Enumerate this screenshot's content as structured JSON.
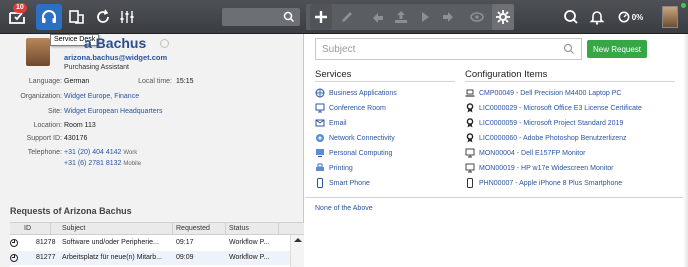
{
  "toolbar": {
    "inbox_badge": "10",
    "percent": "0%"
  },
  "contact": {
    "tooltip": "Service Desk",
    "name_visible": "a Bachus",
    "email": "arizona.bachus@widget.com",
    "job_title": "Purchasing Assistant",
    "fields": {
      "language_label": "Language:",
      "language": "German",
      "local_time_label": "Local time:",
      "local_time": "15:15",
      "organization_label": "Organization:",
      "organization": "Widget Europe, Finance",
      "site_label": "Site:",
      "site": "Widget European Headquarters",
      "location_label": "Location:",
      "location": "Room 113",
      "support_id_label": "Support ID:",
      "support_id": "430176",
      "telephone_label": "Telephone:",
      "phone_work": "+31 (20) 404 4142",
      "phone_work_type": "Work",
      "phone_mobile": "+31 (6) 2781 8132",
      "phone_mobile_type": "Mobile"
    }
  },
  "requests": {
    "title": "Requests of Arizona Bachus",
    "columns": [
      "ID",
      "Subject",
      "Requested",
      "Status"
    ],
    "rows": [
      {
        "id": "81278",
        "subject": "Software und/oder Peripherie...",
        "requested": "09:17",
        "status": "Workflow P..."
      },
      {
        "id": "81277",
        "subject": "Arbeitsplatz für neue(n) Mitarb...",
        "requested": "09:09",
        "status": "Workflow P..."
      }
    ]
  },
  "subject": {
    "placeholder": "Subject"
  },
  "new_request_label": "New Request",
  "services": {
    "title": "Services",
    "items": [
      {
        "label": "Business Applications",
        "icon": "globe-apps-icon"
      },
      {
        "label": "Conference Room",
        "icon": "presentation-icon"
      },
      {
        "label": "Email",
        "icon": "envelope-icon"
      },
      {
        "label": "Network Connectivity",
        "icon": "network-icon"
      },
      {
        "label": "Personal Computing",
        "icon": "computer-icon"
      },
      {
        "label": "Printing",
        "icon": "printer-icon"
      },
      {
        "label": "Smart Phone",
        "icon": "smartphone-icon"
      }
    ]
  },
  "config_items": {
    "title": "Configuration Items",
    "items": [
      {
        "label": "CMP00049 - Dell Precision M4400 Laptop PC",
        "icon": "laptop-icon"
      },
      {
        "label": "LIC0000029 - Microsoft Office E3 License Certificate",
        "icon": "license-ribbon-icon"
      },
      {
        "label": "LIC0000059 - Microsoft Project Standard 2019",
        "icon": "license-ribbon-icon"
      },
      {
        "label": "LIC0000060 - Adobe Photoshop Benutzerlizenz",
        "icon": "license-ribbon-icon"
      },
      {
        "label": "MON00004 - Dell E157FP Monitor",
        "icon": "monitor-icon"
      },
      {
        "label": "MON00019 - HP w17e Widescreen Monitor",
        "icon": "monitor-icon"
      },
      {
        "label": "PHN00007 - Apple iPhone 8 Plus Smartphone",
        "icon": "smartphone-icon"
      }
    ]
  },
  "none_of_above": "None of the Above",
  "colors": {
    "toolbar": "#3f4247",
    "accent": "#2d6fc3",
    "link": "#2a55a0",
    "green": "#37a645",
    "badge": "#e53935"
  }
}
